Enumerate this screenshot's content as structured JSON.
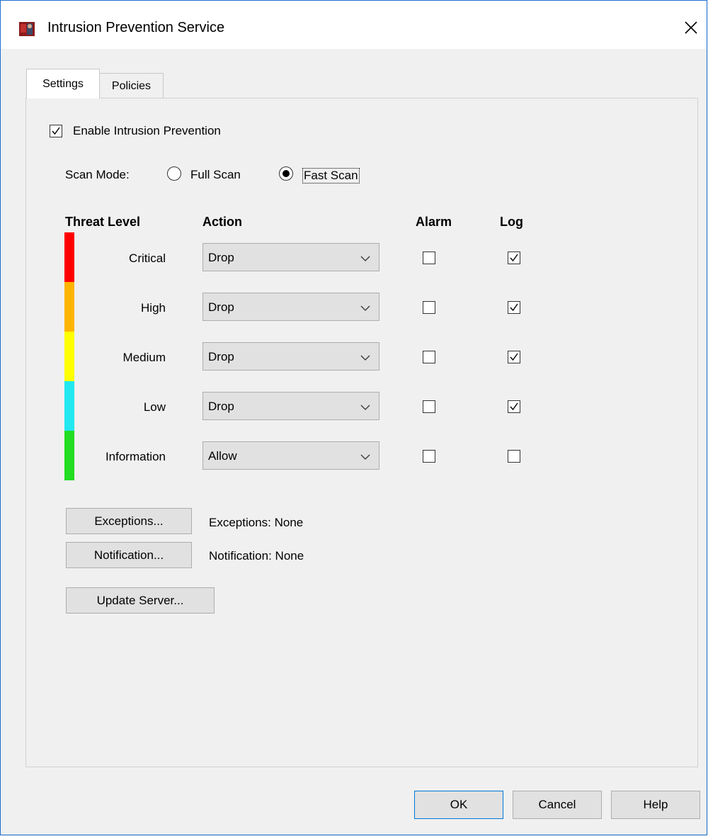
{
  "window": {
    "title": "Intrusion Prevention Service",
    "icon": "firebox-app-icon",
    "close": "close-icon"
  },
  "tabs": [
    {
      "label": "Settings",
      "active": true
    },
    {
      "label": "Policies",
      "active": false
    }
  ],
  "settings": {
    "enable_label": "Enable Intrusion Prevention",
    "enable_checked": true,
    "scan_mode_label": "Scan Mode:",
    "scan_modes": [
      {
        "label": "Full Scan",
        "selected": false
      },
      {
        "label": "Fast Scan",
        "selected": true
      }
    ],
    "table_headers": {
      "threat_level": "Threat Level",
      "action": "Action",
      "alarm": "Alarm",
      "log": "Log"
    },
    "levels": [
      {
        "name": "Critical",
        "color": "#ff0000",
        "action": "Drop",
        "alarm": false,
        "log": true
      },
      {
        "name": "High",
        "color": "#ffb400",
        "action": "Drop",
        "alarm": false,
        "log": true
      },
      {
        "name": "Medium",
        "color": "#ffff00",
        "action": "Drop",
        "alarm": false,
        "log": true
      },
      {
        "name": "Low",
        "color": "#22e8f0",
        "action": "Drop",
        "alarm": false,
        "log": true
      },
      {
        "name": "Information",
        "color": "#22dd22",
        "action": "Allow",
        "alarm": false,
        "log": false
      }
    ],
    "exceptions_button": "Exceptions...",
    "exceptions_status": "Exceptions: None",
    "notification_button": "Notification...",
    "notification_status": "Notification: None",
    "update_server_button": "Update Server..."
  },
  "footer": {
    "ok": "OK",
    "cancel": "Cancel",
    "help": "Help"
  }
}
